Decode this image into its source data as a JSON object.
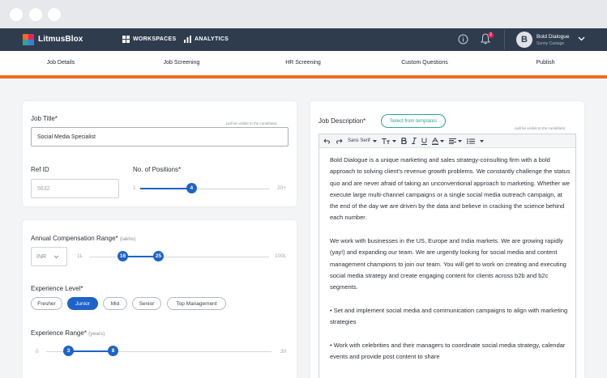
{
  "app": {
    "brand": "LitmusBlox",
    "nav": [
      {
        "label": "WORKSPACES",
        "icon": "grid-icon"
      },
      {
        "label": "ANALYTICS",
        "icon": "bar-chart-icon"
      }
    ],
    "notification_count": "2",
    "user": {
      "name": "Bold Dialogue",
      "subtitle": "Sunny Castage",
      "initial": "B"
    }
  },
  "tabs": [
    "Job Details",
    "Job Screening",
    "HR Screening",
    "Custom Questions",
    "Publish"
  ],
  "job": {
    "title_label": "Job Title*",
    "visible_hint": "(will be visible to the candidate)",
    "title_value": "Social Media Specialist",
    "ref_label": "Ref ID",
    "ref_placeholder": "5632",
    "positions_label": "No. of Positions*",
    "positions": {
      "min": "1",
      "max": "20+",
      "value": "4",
      "fraction": 0.18
    }
  },
  "compensation": {
    "label": "Annual Compensation Range*",
    "unit": "(lakhs)",
    "currency": "INR",
    "min": "1L",
    "max": "100L",
    "low": "16",
    "high": "25"
  },
  "experience_level": {
    "label": "Experience Level*",
    "options": [
      "Fresher",
      "Junior",
      "Mid",
      "Senior",
      "Top Management"
    ],
    "selected": "Junior"
  },
  "experience_range": {
    "label": "Experience Range*",
    "unit": "(years)",
    "min": "0",
    "max": "30",
    "low": "3",
    "high": "8"
  },
  "description": {
    "label": "Job Description*",
    "template_button": "Select from templates",
    "visible_hint": "(will be visible to the candidate)",
    "font": "Sans Serif",
    "paragraphs": [
      "Bold Dialogue is a unique marketing and sales strategy-consulting firm with a bold approach to solving client's revenue growth problems. We constantly challenge the status quo and are never afraid of taking an unconventional approach to marketing. Whether we execute large multi-channel campaigns or a single social media outreach campaign, at the end of the day we are driven by the data and believe in cracking the science behind each number.",
      "We work with businesses in the US, Europe and India markets. We are growing rapidly (yay!) and expanding our team. We are urgently looking for social media and content management champions to join our team. You will get to work on creating and executing social media strategy and create engaging content for clients across b2b and b2c segments.",
      "• Set and implement social media and communication campaigns to align with marketing strategies",
      "• Work with celebrities and their managers to coordinate social media strategy, calendar events and provide post content to share"
    ]
  },
  "colors": {
    "nav_bg": "#2f3c4e",
    "accent_blue": "#1e63c8",
    "accent_orange": "#f26b21",
    "teal": "#2ea592"
  }
}
